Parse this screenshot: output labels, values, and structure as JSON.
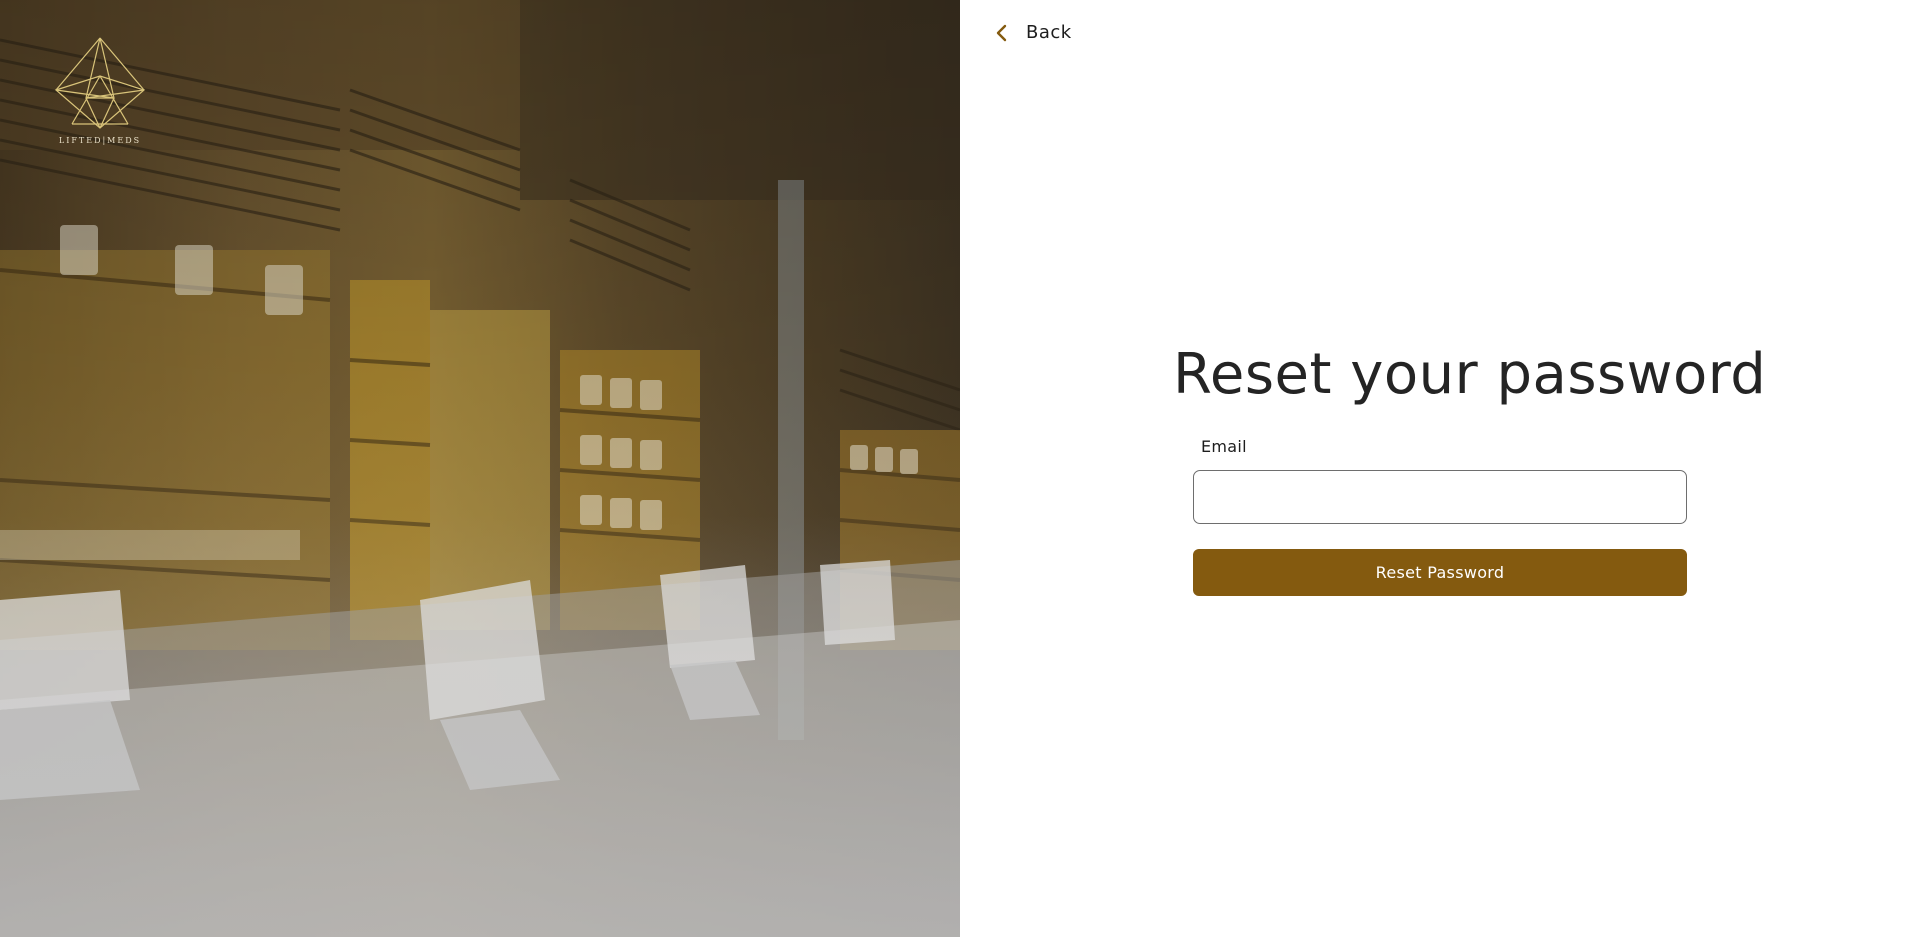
{
  "brand": {
    "wordmark": "LIFTED|MEDS",
    "logo_icon": "star-of-lines-logo",
    "logo_color": "#d9c47a"
  },
  "hero": {
    "image": "dispensary-interior-photo"
  },
  "nav": {
    "back_label": "Back",
    "back_icon": "chevron-left-icon"
  },
  "form": {
    "title": "Reset your password",
    "email_label": "Email",
    "email_value": "",
    "email_placeholder": "",
    "submit_label": "Reset Password"
  },
  "colors": {
    "accent": "#845a0f",
    "text": "#242424",
    "input_border": "#6e6e6e"
  }
}
